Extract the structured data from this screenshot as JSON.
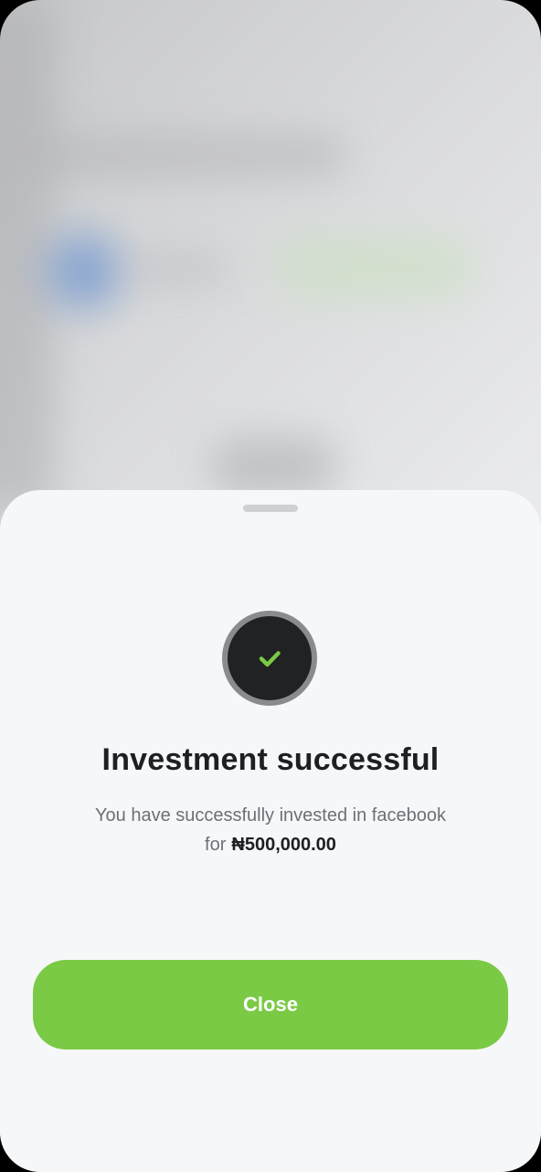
{
  "sheet": {
    "icon": "check-icon",
    "title": "Investment successful",
    "message_text": "You have successfully invested in facebook",
    "message_for": "for",
    "amount": "₦500,000.00",
    "close_label": "Close"
  },
  "colors": {
    "accent": "#7aca45",
    "check": "#7aca45",
    "circle_fill": "#212223",
    "circle_ring": "#8a8b8e",
    "sheet_bg": "#f6f7f9",
    "title": "#1e1f21",
    "message": "#6e7078"
  }
}
